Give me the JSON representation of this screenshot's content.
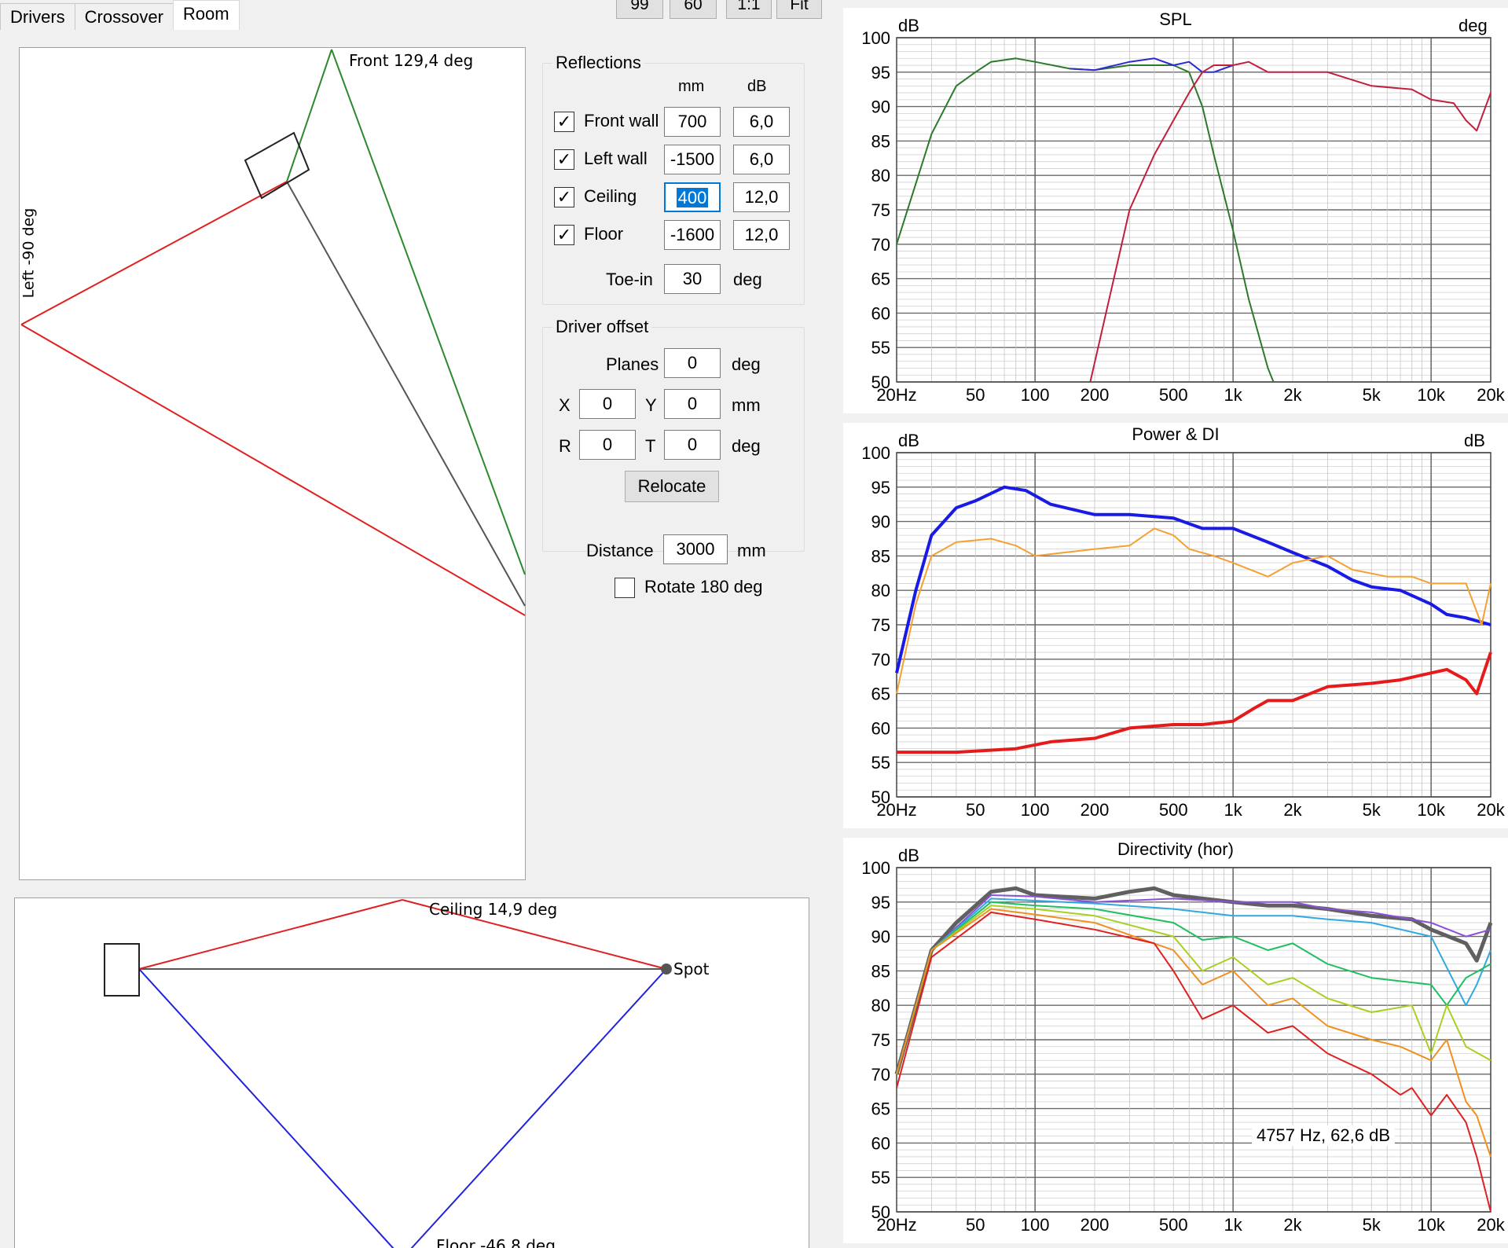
{
  "tabs": [
    {
      "label": "Drivers"
    },
    {
      "label": "Crossover"
    },
    {
      "label": "Room"
    }
  ],
  "toolbar": {
    "b1": "99",
    "b2": "60",
    "b3": "1:1",
    "b4": "Fit"
  },
  "topview": {
    "front_label": "Front 129,4 deg",
    "left_label": "Left -90 deg"
  },
  "sideview": {
    "ceiling_label": "Ceiling 14,9 deg",
    "floor_label": "Floor -46,8 deg",
    "spot_label": "Spot"
  },
  "reflections": {
    "title": "Reflections",
    "col_mm": "mm",
    "col_db": "dB",
    "rows": [
      {
        "label": "Front wall",
        "checked": true,
        "mm": "700",
        "db": "6,0"
      },
      {
        "label": "Left wall",
        "checked": true,
        "mm": "-1500",
        "db": "6,0"
      },
      {
        "label": "Ceiling",
        "checked": true,
        "mm": "400",
        "db": "12,0"
      },
      {
        "label": "Floor",
        "checked": true,
        "mm": "-1600",
        "db": "12,0"
      }
    ],
    "toein_label": "Toe-in",
    "toein_value": "30",
    "toein_unit": "deg"
  },
  "offset": {
    "title": "Driver offset",
    "planes_label": "Planes",
    "planes_value": "0",
    "planes_unit": "deg",
    "x_label": "X",
    "x_value": "0",
    "y_label": "Y",
    "y_value": "0",
    "xy_unit": "mm",
    "r_label": "R",
    "r_value": "0",
    "t_label": "T",
    "t_value": "0",
    "rt_unit": "deg",
    "relocate": "Relocate"
  },
  "distance": {
    "label": "Distance",
    "value": "3000",
    "unit": "mm",
    "rotate_label": "Rotate 180 deg",
    "rotate_checked": false
  },
  "check_mark": "✓",
  "plot_labels": {
    "y_ticks": [
      "100",
      "95",
      "90",
      "85",
      "80",
      "75",
      "70",
      "65",
      "60",
      "55",
      "50"
    ],
    "x_ticks": [
      "20Hz",
      "50",
      "100",
      "200",
      "500",
      "1k",
      "2k",
      "5k",
      "10k",
      "20k"
    ]
  },
  "chart_data": [
    {
      "type": "line",
      "title": "SPL",
      "ylabel": "dB",
      "y2label": "deg",
      "ylim": [
        50,
        100
      ],
      "xlim": [
        20,
        20000
      ],
      "x_scale": "log",
      "series": [
        {
          "color": "#2b7a2b",
          "points": [
            [
              20,
              70
            ],
            [
              30,
              86
            ],
            [
              40,
              93
            ],
            [
              50,
              95
            ],
            [
              60,
              96.5
            ],
            [
              80,
              97
            ],
            [
              100,
              96.5
            ],
            [
              150,
              95.5
            ],
            [
              200,
              95.3
            ],
            [
              300,
              96
            ],
            [
              500,
              96
            ],
            [
              600,
              95
            ],
            [
              700,
              90
            ],
            [
              800,
              83
            ],
            [
              1000,
              72
            ],
            [
              1200,
              62
            ],
            [
              1500,
              52
            ],
            [
              1600,
              50
            ]
          ]
        },
        {
          "color": "#2b2bd0",
          "points": [
            [
              150,
              95.5
            ],
            [
              200,
              95.3
            ],
            [
              300,
              96.5
            ],
            [
              400,
              97
            ],
            [
              500,
              96
            ],
            [
              600,
              96.5
            ],
            [
              700,
              95
            ],
            [
              800,
              95
            ],
            [
              1000,
              96
            ]
          ]
        },
        {
          "color": "#c0203c",
          "points": [
            [
              190,
              50
            ],
            [
              250,
              65
            ],
            [
              300,
              75
            ],
            [
              400,
              83
            ],
            [
              500,
              88
            ],
            [
              600,
              92
            ],
            [
              700,
              95
            ],
            [
              800,
              96
            ],
            [
              1000,
              96
            ],
            [
              1200,
              96.5
            ],
            [
              1500,
              95
            ],
            [
              2000,
              95
            ],
            [
              3000,
              95
            ],
            [
              5000,
              93
            ],
            [
              8000,
              92.5
            ],
            [
              10000,
              91
            ],
            [
              13000,
              90.5
            ],
            [
              15000,
              88
            ],
            [
              17000,
              86.5
            ],
            [
              20000,
              92
            ]
          ]
        }
      ]
    },
    {
      "type": "line",
      "title": "Power & DI",
      "ylabel": "dB",
      "y2label": "dB",
      "ylim": [
        50,
        100
      ],
      "xlim": [
        20,
        20000
      ],
      "x_scale": "log",
      "series": [
        {
          "color": "#1a1ae6",
          "points": [
            [
              20,
              68
            ],
            [
              25,
              80
            ],
            [
              30,
              88
            ],
            [
              40,
              92
            ],
            [
              50,
              93
            ],
            [
              70,
              95
            ],
            [
              90,
              94.5
            ],
            [
              120,
              92.5
            ],
            [
              200,
              91
            ],
            [
              300,
              91
            ],
            [
              500,
              90.5
            ],
            [
              700,
              89
            ],
            [
              1000,
              89
            ],
            [
              1500,
              87
            ],
            [
              2000,
              85.5
            ],
            [
              3000,
              83.5
            ],
            [
              4000,
              81.5
            ],
            [
              5000,
              80.5
            ],
            [
              7000,
              80
            ],
            [
              10000,
              78
            ],
            [
              12000,
              76.5
            ],
            [
              15000,
              76
            ],
            [
              20000,
              75
            ]
          ]
        },
        {
          "color": "#f5a030",
          "points": [
            [
              20,
              65
            ],
            [
              25,
              78
            ],
            [
              30,
              85
            ],
            [
              40,
              87
            ],
            [
              60,
              87.5
            ],
            [
              80,
              86.5
            ],
            [
              100,
              85
            ],
            [
              200,
              86
            ],
            [
              300,
              86.5
            ],
            [
              400,
              89
            ],
            [
              500,
              88
            ],
            [
              600,
              86
            ],
            [
              800,
              85
            ],
            [
              1000,
              84
            ],
            [
              1500,
              82
            ],
            [
              2000,
              84
            ],
            [
              3000,
              85
            ],
            [
              4000,
              83
            ],
            [
              6000,
              82
            ],
            [
              8000,
              82
            ],
            [
              10000,
              81
            ],
            [
              15000,
              81
            ],
            [
              18000,
              75
            ],
            [
              20000,
              81
            ]
          ]
        },
        {
          "color": "#e61a1a",
          "points": [
            [
              20,
              56.5
            ],
            [
              40,
              56.5
            ],
            [
              80,
              57
            ],
            [
              120,
              58
            ],
            [
              200,
              58.5
            ],
            [
              300,
              60
            ],
            [
              500,
              60.5
            ],
            [
              700,
              60.5
            ],
            [
              1000,
              61
            ],
            [
              1300,
              63
            ],
            [
              1500,
              64
            ],
            [
              2000,
              64
            ],
            [
              3000,
              66
            ],
            [
              5000,
              66.5
            ],
            [
              7000,
              67
            ],
            [
              10000,
              68
            ],
            [
              12000,
              68.5
            ],
            [
              15000,
              67
            ],
            [
              17000,
              65
            ],
            [
              20000,
              71
            ]
          ]
        }
      ]
    },
    {
      "type": "line",
      "title": "Directivity (hor)",
      "ylabel": "dB",
      "ylim": [
        50,
        100
      ],
      "xlim": [
        20,
        20000
      ],
      "x_scale": "log",
      "annotation": "4757 Hz, 62,6 dB",
      "series": [
        {
          "color": "#606060",
          "points": [
            [
              20,
              70
            ],
            [
              30,
              88
            ],
            [
              40,
              92
            ],
            [
              60,
              96.5
            ],
            [
              80,
              97
            ],
            [
              100,
              96
            ],
            [
              200,
              95.5
            ],
            [
              300,
              96.5
            ],
            [
              400,
              97
            ],
            [
              500,
              96
            ],
            [
              700,
              95.5
            ],
            [
              1000,
              95
            ],
            [
              1500,
              94.5
            ],
            [
              2000,
              94.5
            ],
            [
              3000,
              94
            ],
            [
              5000,
              93
            ],
            [
              8000,
              92.5
            ],
            [
              10000,
              91
            ],
            [
              15000,
              89
            ],
            [
              17000,
              86.5
            ],
            [
              20000,
              92
            ]
          ]
        },
        {
          "color": "#8a50d8",
          "points": [
            [
              20,
              70
            ],
            [
              30,
              88
            ],
            [
              60,
              96
            ],
            [
              100,
              95.8
            ],
            [
              200,
              95
            ],
            [
              500,
              95.5
            ],
            [
              1000,
              95
            ],
            [
              2000,
              95
            ],
            [
              3000,
              94
            ],
            [
              5000,
              93.5
            ],
            [
              10000,
              92
            ],
            [
              15000,
              90
            ],
            [
              20000,
              91
            ]
          ]
        },
        {
          "color": "#30a8e0",
          "points": [
            [
              20,
              70
            ],
            [
              30,
              88
            ],
            [
              60,
              95.5
            ],
            [
              100,
              95.2
            ],
            [
              200,
              94.8
            ],
            [
              500,
              94
            ],
            [
              1000,
              93
            ],
            [
              2000,
              93
            ],
            [
              3000,
              92.5
            ],
            [
              5000,
              92
            ],
            [
              10000,
              90
            ],
            [
              15000,
              80
            ],
            [
              17000,
              83
            ],
            [
              20000,
              88
            ]
          ]
        },
        {
          "color": "#20c060",
          "points": [
            [
              20,
              70
            ],
            [
              30,
              88
            ],
            [
              60,
              95
            ],
            [
              100,
              94.5
            ],
            [
              200,
              94
            ],
            [
              500,
              92
            ],
            [
              700,
              89.5
            ],
            [
              1000,
              90
            ],
            [
              1500,
              88
            ],
            [
              2000,
              89
            ],
            [
              3000,
              86
            ],
            [
              5000,
              84
            ],
            [
              10000,
              83
            ],
            [
              12000,
              80
            ],
            [
              15000,
              84
            ],
            [
              20000,
              86
            ]
          ]
        },
        {
          "color": "#a8d020",
          "points": [
            [
              20,
              70
            ],
            [
              30,
              88
            ],
            [
              60,
              94.5
            ],
            [
              100,
              94
            ],
            [
              200,
              93
            ],
            [
              500,
              90
            ],
            [
              700,
              85
            ],
            [
              1000,
              87
            ],
            [
              1500,
              83
            ],
            [
              2000,
              84
            ],
            [
              3000,
              81
            ],
            [
              5000,
              79
            ],
            [
              8000,
              80
            ],
            [
              10000,
              73
            ],
            [
              12000,
              80
            ],
            [
              15000,
              74
            ],
            [
              20000,
              72
            ]
          ]
        },
        {
          "color": "#f09020",
          "points": [
            [
              20,
              70
            ],
            [
              30,
              88
            ],
            [
              60,
              94
            ],
            [
              100,
              93.2
            ],
            [
              200,
              92
            ],
            [
              500,
              88
            ],
            [
              700,
              83
            ],
            [
              1000,
              85
            ],
            [
              1500,
              80
            ],
            [
              2000,
              81
            ],
            [
              3000,
              77
            ],
            [
              5000,
              75
            ],
            [
              7000,
              74
            ],
            [
              10000,
              72
            ],
            [
              12000,
              75
            ],
            [
              15000,
              66
            ],
            [
              17000,
              64
            ],
            [
              20000,
              58
            ]
          ]
        },
        {
          "color": "#e02020",
          "points": [
            [
              20,
              68
            ],
            [
              30,
              87
            ],
            [
              60,
              93.5
            ],
            [
              100,
              92.5
            ],
            [
              200,
              91
            ],
            [
              400,
              89
            ],
            [
              500,
              85
            ],
            [
              700,
              78
            ],
            [
              1000,
              80
            ],
            [
              1500,
              76
            ],
            [
              2000,
              77
            ],
            [
              3000,
              73
            ],
            [
              5000,
              70
            ],
            [
              7000,
              67
            ],
            [
              8000,
              68
            ],
            [
              10000,
              64
            ],
            [
              12000,
              67
            ],
            [
              15000,
              63
            ],
            [
              17000,
              58
            ],
            [
              20000,
              50
            ]
          ]
        }
      ]
    }
  ]
}
